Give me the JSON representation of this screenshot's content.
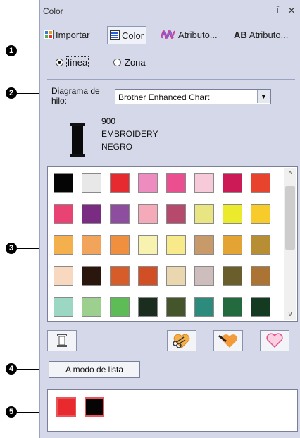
{
  "panel": {
    "title": "Color",
    "pin_glyph": "⍑",
    "close_glyph": "✕"
  },
  "tabs": [
    {
      "label": "Importar",
      "icon": "import-icon"
    },
    {
      "label": "Color",
      "icon": "color-icon"
    },
    {
      "label": "Atributo...",
      "icon": "stitch-attribute-icon"
    },
    {
      "label": "Atributo...",
      "icon": "text-attribute-icon",
      "prefix": "AB"
    }
  ],
  "target": {
    "options": [
      "línea",
      "Zona"
    ],
    "selected": "línea"
  },
  "thread_chart": {
    "label": "Diagrama de hilo:",
    "value": "Brother Enhanced Chart"
  },
  "current_thread": {
    "number": "900",
    "brand": "EMBROIDERY",
    "name": "NEGRO",
    "color": "#0a0a0a"
  },
  "palette": {
    "rows": [
      [
        "#050505",
        "#e8e8e8",
        "#e62a2f",
        "#ee8cc0",
        "#ec4f8f",
        "#f6cad8",
        "#cb1a55",
        "#e8442d"
      ],
      [
        "#e94374",
        "#7a2c82",
        "#8e4ea0",
        "#f4aab9",
        "#b54a6c",
        "#e8e582",
        "#ecea2c",
        "#f6cb2a"
      ],
      [
        "#f4b04d",
        "#f2a55a",
        "#f08f3e",
        "#f8f2b0",
        "#f8e98a",
        "#c89a6a",
        "#e4a433",
        "#b88e35"
      ],
      [
        "#f8d9c0",
        "#2a160c",
        "#d65d2a",
        "#d24e25",
        "#ead7b0",
        "#cdbdbd",
        "#6a5e2c",
        "#ab7434"
      ],
      [
        "#9bd7c2",
        "#9dd08e",
        "#5ebc57",
        "#1a2d1e",
        "#44552b",
        "#2c8b7c",
        "#236a3f",
        "#153a22"
      ]
    ]
  },
  "tools": [
    "thread-spool-icon",
    "scissors-heart-icon",
    "brush-heart-icon",
    "heart-outline-icon"
  ],
  "list_button": "A modo de lista",
  "used_colors": [
    "#e82a2f",
    "#050505"
  ],
  "callouts": [
    "1",
    "2",
    "3",
    "4",
    "5"
  ]
}
